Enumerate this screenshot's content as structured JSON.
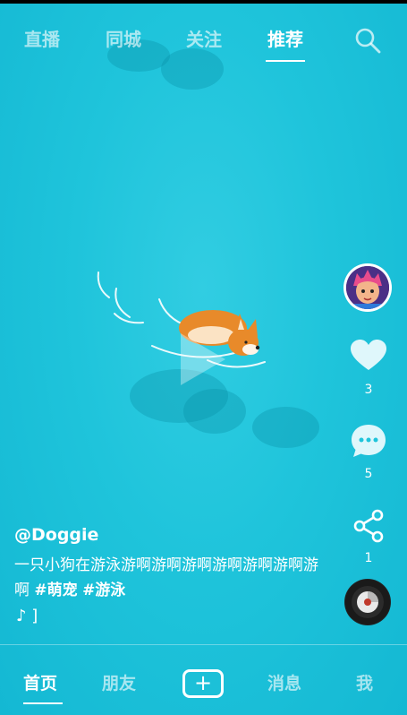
{
  "top_tabs": [
    {
      "label": "直播",
      "active": false
    },
    {
      "label": "同城",
      "active": false
    },
    {
      "label": "关注",
      "active": false
    },
    {
      "label": "推荐",
      "active": true
    }
  ],
  "icons": {
    "search": "search-icon",
    "play": "play-icon",
    "like": "heart-icon",
    "comment": "comment-icon",
    "share": "share-icon",
    "music_note": "music-note-icon",
    "add": "plus-icon"
  },
  "post": {
    "author": "@Doggie",
    "caption_text": "一只小狗在游泳游啊游啊游啊游啊游啊游啊游啊",
    "tags": [
      "#萌宠",
      "#游泳"
    ],
    "music_text": "♪ ]"
  },
  "actions": {
    "like_count": "3",
    "comment_count": "5",
    "share_count": "1"
  },
  "bottom_nav": [
    {
      "label": "首页",
      "active": true
    },
    {
      "label": "朋友",
      "active": false
    },
    {
      "label": "消息",
      "active": false
    },
    {
      "label": "我",
      "active": false
    }
  ],
  "colors": {
    "video_bg": "#1fc4db",
    "accent_red": "#e8597a",
    "accent_cyan": "#69d6e8"
  }
}
